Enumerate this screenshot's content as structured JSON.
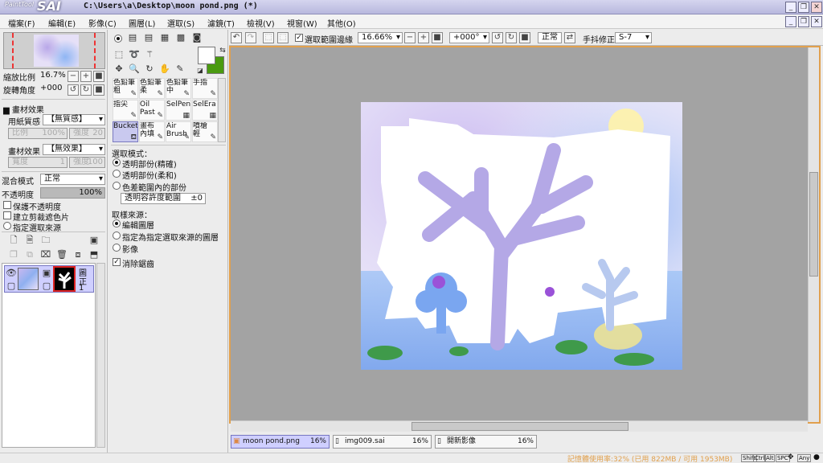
{
  "window": {
    "app_name": "PaintTool",
    "app_logo": "SAI",
    "title": "C:\\Users\\a\\Desktop\\moon pond.png (*)"
  },
  "menu": [
    "檔案(F)",
    "編輯(E)",
    "影像(C)",
    "圖層(L)",
    "選取(S)",
    "濾鏡(T)",
    "檢視(V)",
    "視窗(W)",
    "其他(O)"
  ],
  "navigator": {
    "zoom_label": "縮放比例",
    "zoom_value": "16.7%",
    "rotate_label": "旋轉角度",
    "rotate_value": "+000"
  },
  "paper_effect": {
    "section_title": "畫材效果",
    "paper_label": "用紙質感",
    "paper_value": "【無質感】",
    "scale_label": "比例",
    "scale_value": "100%",
    "strength_label": "強度",
    "strength_value": "20",
    "effect_label": "畫材效果",
    "effect_value": "【無效果】",
    "width_label": "寬度",
    "width_value": "1",
    "strength2_label": "強度",
    "strength2_value": "100"
  },
  "layer_props": {
    "blend_label": "混合模式",
    "blend_value": "正常",
    "opacity_label": "不透明度",
    "opacity_value": "100%",
    "opacity_level": 1.0,
    "preserve_opacity": "保護不透明度",
    "clipping": "建立剪裁遮色片",
    "selection_source": "指定選取來源"
  },
  "layer_item": {
    "text_line1": "圖",
    "text_line2": "正",
    "text_line3": "1"
  },
  "tools": {
    "rows": [
      [
        {
          "l1": "色鉛筆",
          "l2": "粗"
        },
        {
          "l1": "色鉛筆",
          "l2": "柔"
        },
        {
          "l1": "色鉛筆",
          "l2": "中"
        },
        {
          "l1": "手指",
          "l2": ""
        }
      ],
      [
        {
          "l1": "指尖",
          "l2": ""
        },
        {
          "l1": "Oil",
          "l2": "Past"
        },
        {
          "l1": "SelPen",
          "l2": ""
        },
        {
          "l1": "SelEra",
          "l2": ""
        }
      ],
      [
        {
          "l1": "Bucket",
          "l2": ""
        },
        {
          "l1": "畫布",
          "l2": "內填"
        },
        {
          "l1": "Air",
          "l2": "Brush"
        },
        {
          "l1": "噴槍",
          "l2": "輕"
        }
      ]
    ],
    "selected_tool": "Bucket"
  },
  "bucket_options": {
    "mode_title": "選取模式：",
    "mode_options": [
      "透明部份(精確)",
      "透明部份(柔和)",
      "色差範圍內的部份"
    ],
    "tolerance_label": "透明容許度範圍",
    "tolerance_value": "±0",
    "source_title": "取樣來源：",
    "source_options": [
      "編輯圖層",
      "指定為指定選取來源的圖層",
      "影像"
    ],
    "antialias": "消除鋸齒"
  },
  "toolbar": {
    "show_selection_label": "選取範圍邊緣",
    "zoom": "16.66%",
    "angle": "+000°",
    "blend": "正常",
    "stabilizer_label": "手抖修正",
    "stabilizer_value": "S-7"
  },
  "file_tabs": [
    {
      "name": "moon pond.png",
      "zoom": "16%"
    },
    {
      "name": "img009.sai",
      "zoom": "16%"
    },
    {
      "name": "開新影像",
      "zoom": "16%"
    }
  ],
  "status": {
    "memory": "記憶體使用率:32% (已用 822MB / 可用 1953MB)",
    "keys": [
      "Shift",
      "Ctrl",
      "Alt",
      "SPC",
      "Any"
    ]
  },
  "colors": {
    "accent": "#e1a04d",
    "selected_tab": "#cfcfff",
    "foreground": "#ffffff",
    "background": "#4a9a10"
  }
}
